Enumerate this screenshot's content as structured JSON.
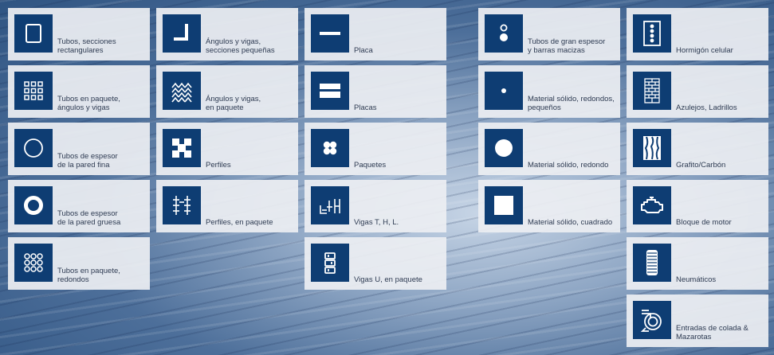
{
  "tiles": [
    {
      "label": "Tubos, secciones\nrectangulares",
      "icon": "rect-tube-icon"
    },
    {
      "label": "Tubos en paquete,\nángulos y vigas",
      "icon": "bundle-grid-icon"
    },
    {
      "label": "Tubos de espesor\nde la pared fina",
      "icon": "thin-wall-tube-icon"
    },
    {
      "label": "Tubos de espesor\nde la pared gruesa",
      "icon": "thick-wall-tube-icon"
    },
    {
      "label": "Tubos en paquete,\nredondos",
      "icon": "round-bundle-icon"
    },
    {
      "label": "Ángulos y vigas,\nsecciones pequeñas",
      "icon": "angle-icon"
    },
    {
      "label": "Ángulos y vigas,\nen paquete",
      "icon": "angle-bundle-icon"
    },
    {
      "label": "Perfiles",
      "icon": "profile-icon"
    },
    {
      "label": "Perfiles, en paquete",
      "icon": "profile-bundle-icon"
    },
    {
      "label": "Placa",
      "icon": "plate-icon"
    },
    {
      "label": "Placas",
      "icon": "plates-icon"
    },
    {
      "label": "Paquetes",
      "icon": "packages-icon"
    },
    {
      "label": "Vigas T, H, L.",
      "icon": "beams-thl-icon"
    },
    {
      "label": "Vigas U, en paquete",
      "icon": "u-beam-bundle-icon"
    },
    {
      "label": "Tubos de gran espesor\ny barras macizas",
      "icon": "thick-tube-bars-icon"
    },
    {
      "label": "Material sólido, redondos,\npequeños",
      "icon": "small-solid-round-icon"
    },
    {
      "label": "Material sólido, redondo",
      "icon": "solid-round-icon"
    },
    {
      "label": "Material sólido, cuadrado",
      "icon": "solid-square-icon"
    },
    {
      "label": "Hormigón celular",
      "icon": "cellular-concrete-icon"
    },
    {
      "label": "Azulejos, Ladrillos",
      "icon": "bricks-icon"
    },
    {
      "label": "Grafito/Carbón",
      "icon": "graphite-icon"
    },
    {
      "label": "Bloque de motor",
      "icon": "engine-block-icon"
    },
    {
      "label": "Neumáticos",
      "icon": "tire-icon"
    },
    {
      "label": "Entradas de colada &\nMazarotas",
      "icon": "sprue-riser-icon"
    }
  ]
}
